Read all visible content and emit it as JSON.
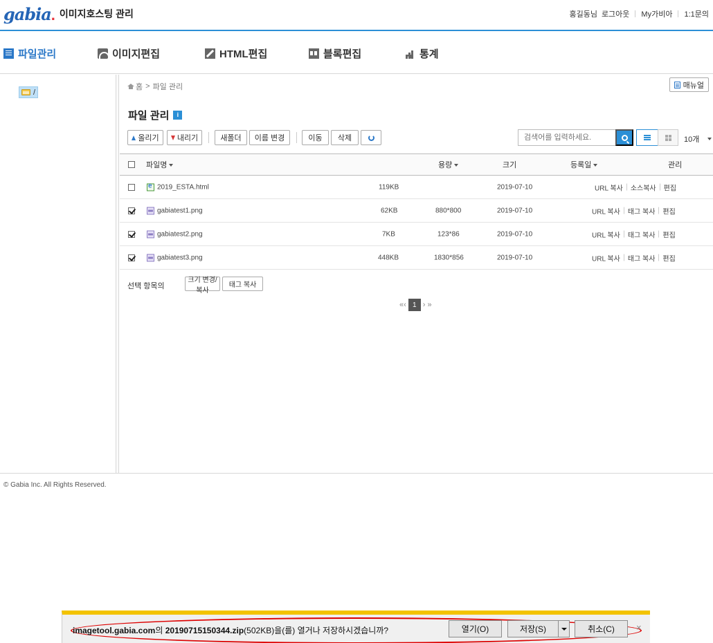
{
  "header": {
    "logo_text": "gabia",
    "logo_dot": ".",
    "app_title": "이미지호스팅 관리",
    "user_name": "홍길동님",
    "logout": "로그아웃",
    "my_gabia": "My가비아",
    "inquiry": "1:1문의"
  },
  "nav": {
    "items": [
      {
        "label": "파일관리",
        "icon": "file-list-icon",
        "active": true
      },
      {
        "label": "이미지편집",
        "icon": "image-edit-icon"
      },
      {
        "label": "HTML편집",
        "icon": "pencil-icon"
      },
      {
        "label": "블록편집",
        "icon": "block-icon"
      },
      {
        "label": "통계",
        "icon": "bar-chart-icon"
      }
    ]
  },
  "tree": {
    "root_label": "/"
  },
  "breadcrumb": {
    "home": "홈",
    "sep": ">",
    "current": "파일 관리"
  },
  "manual_label": "매뉴얼",
  "page": {
    "title": "파일 관리",
    "info_badge": "i"
  },
  "toolbar": {
    "upload": "올리기",
    "download": "내리기",
    "new_folder": "새폴더",
    "rename": "이름 변경",
    "move": "이동",
    "delete": "삭제",
    "search_placeholder": "검색어를 입력하세요.",
    "per_page": "10개"
  },
  "table": {
    "columns": {
      "name": "파일명",
      "capacity": "용량",
      "size": "크기",
      "date": "등록일",
      "manage": "관리"
    },
    "rows": [
      {
        "name": "2019_ESTA.html",
        "type": "html",
        "capacity": "119KB",
        "size": "",
        "date": "2019-07-10",
        "checked": false,
        "action1": "URL 복사",
        "action2": "소스복사",
        "action3": "편집"
      },
      {
        "name": "gabiatest1.png",
        "type": "png",
        "capacity": "62KB",
        "size": "880*800",
        "date": "2019-07-10",
        "checked": true,
        "action1": "URL 복사",
        "action2": "태그 복사",
        "action3": "편집"
      },
      {
        "name": "gabiatest2.png",
        "type": "png",
        "capacity": "7KB",
        "size": "123*86",
        "date": "2019-07-10",
        "checked": true,
        "action1": "URL 복사",
        "action2": "태그 복사",
        "action3": "편집"
      },
      {
        "name": "gabiatest3.png",
        "type": "png",
        "capacity": "448KB",
        "size": "1830*856",
        "date": "2019-07-10",
        "checked": true,
        "action1": "URL 복사",
        "action2": "태그 복사",
        "action3": "편집"
      }
    ]
  },
  "selection": {
    "label": "선택 항목의",
    "resize_copy": "크기 변경/복사",
    "tag_copy": "태그 복사"
  },
  "pager": {
    "first": "«",
    "prev": "‹",
    "current": "1",
    "next": "›",
    "last": "»"
  },
  "footer": {
    "copyright": "© Gabia Inc. All Rights Reserved."
  },
  "download_bar": {
    "site": "imagetool.gabia.com",
    "part1": "의 ",
    "filename": "20190715150344.zip",
    "part2": "(502KB)을(를) 열거나 저장하시겠습니까?",
    "open": "열기(O)",
    "save": "저장(S)",
    "cancel": "취소(C)",
    "close": "×",
    "accent_color": "#f3c300",
    "highlight_color": "#dd0000"
  }
}
